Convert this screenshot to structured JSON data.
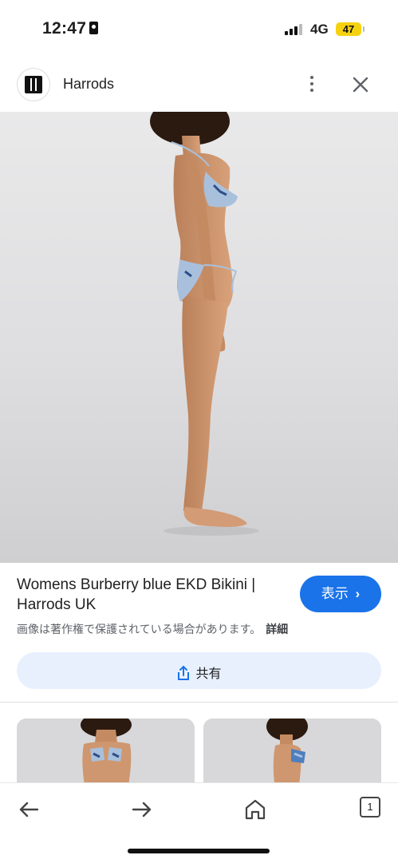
{
  "status_bar": {
    "time": "12:47",
    "network": "4G",
    "battery": "47"
  },
  "header": {
    "site_name": "Harrods",
    "logo_icon": "harrods-logo-icon",
    "menu_icon": "more-vert-icon",
    "close_icon": "close-icon"
  },
  "result": {
    "title": "Womens Burberry blue EKD Bikini | Harrods UK",
    "view_button": "表示",
    "copyright_notice": "画像は著作権で保護されている場合があります。",
    "details_link": "詳細",
    "share_button": "共有"
  },
  "bottom_bar": {
    "tab_count": "1",
    "back_icon": "arrow-left-icon",
    "forward_icon": "arrow-right-icon",
    "home_icon": "home-icon"
  },
  "colors": {
    "accent": "#1a73e8",
    "share_bg": "#e8f0fe",
    "battery": "#f5d20f"
  }
}
